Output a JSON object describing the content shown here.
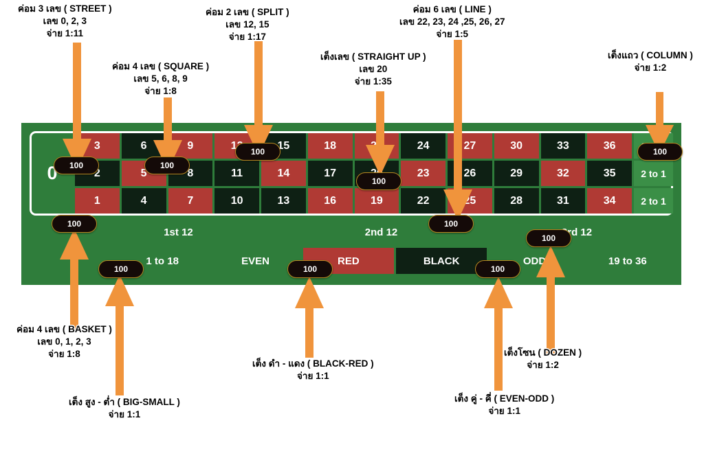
{
  "table": {
    "zero_label": "0",
    "numbers": [
      {
        "n": "3",
        "color": "red"
      },
      {
        "n": "6",
        "color": "black"
      },
      {
        "n": "9",
        "color": "red"
      },
      {
        "n": "12",
        "color": "red"
      },
      {
        "n": "15",
        "color": "black"
      },
      {
        "n": "18",
        "color": "red"
      },
      {
        "n": "21",
        "color": "red"
      },
      {
        "n": "24",
        "color": "black"
      },
      {
        "n": "27",
        "color": "red"
      },
      {
        "n": "30",
        "color": "red"
      },
      {
        "n": "33",
        "color": "black"
      },
      {
        "n": "36",
        "color": "red"
      },
      {
        "n": "2",
        "color": "black"
      },
      {
        "n": "5",
        "color": "red"
      },
      {
        "n": "8",
        "color": "black"
      },
      {
        "n": "11",
        "color": "black"
      },
      {
        "n": "14",
        "color": "red"
      },
      {
        "n": "17",
        "color": "black"
      },
      {
        "n": "20",
        "color": "black"
      },
      {
        "n": "23",
        "color": "red"
      },
      {
        "n": "26",
        "color": "black"
      },
      {
        "n": "29",
        "color": "black"
      },
      {
        "n": "32",
        "color": "red"
      },
      {
        "n": "35",
        "color": "black"
      },
      {
        "n": "1",
        "color": "red"
      },
      {
        "n": "4",
        "color": "black"
      },
      {
        "n": "7",
        "color": "red"
      },
      {
        "n": "10",
        "color": "black"
      },
      {
        "n": "13",
        "color": "black"
      },
      {
        "n": "16",
        "color": "red"
      },
      {
        "n": "19",
        "color": "red"
      },
      {
        "n": "22",
        "color": "black"
      },
      {
        "n": "25",
        "color": "red"
      },
      {
        "n": "28",
        "color": "black"
      },
      {
        "n": "31",
        "color": "black"
      },
      {
        "n": "34",
        "color": "red"
      }
    ],
    "column_bets": [
      "2 to 1",
      "2 to 1",
      "2 to 1"
    ],
    "dozens": [
      "1st 12",
      "2nd 12",
      "3rd 12"
    ],
    "outside": [
      {
        "label": "1 to 18",
        "color": "green"
      },
      {
        "label": "EVEN",
        "color": "green"
      },
      {
        "label": "RED",
        "color": "red"
      },
      {
        "label": "BLACK",
        "color": "black"
      },
      {
        "label": "ODD",
        "color": "green"
      },
      {
        "label": "19 to 36",
        "color": "green"
      }
    ],
    "colors": {
      "felt": "#2f7d3b",
      "cell_red": "#b03a34",
      "cell_black": "#0e2014",
      "column_green": "#3b8f47",
      "line": "#ffffff",
      "chip_body": "#140a08",
      "chip_rim": "#b98a22",
      "arrow": "#f0943c"
    }
  },
  "chips": [
    {
      "name": "chip-street",
      "value": "100"
    },
    {
      "name": "chip-square",
      "value": "100"
    },
    {
      "name": "chip-split",
      "value": "100"
    },
    {
      "name": "chip-straight-up",
      "value": "100"
    },
    {
      "name": "chip-line",
      "value": "100"
    },
    {
      "name": "chip-column",
      "value": "100"
    },
    {
      "name": "chip-basket",
      "value": "100"
    },
    {
      "name": "chip-big-small",
      "value": "100"
    },
    {
      "name": "chip-black-red",
      "value": "100"
    },
    {
      "name": "chip-even-odd",
      "value": "100"
    },
    {
      "name": "chip-dozen",
      "value": "100"
    }
  ],
  "annotations": {
    "street": {
      "l1": "ค่อม 3 เลข ( STREET )",
      "l2": "เลข 0, 2, 3",
      "l3": "จ่าย 1:11"
    },
    "square": {
      "l1": "ค่อม 4 เลข ( SQUARE )",
      "l2": "เลข 5, 6, 8, 9",
      "l3": "จ่าย 1:8"
    },
    "split": {
      "l1": "ค่อม 2 เลข ( SPLIT )",
      "l2": "เลข 12, 15",
      "l3": "จ่าย 1:17"
    },
    "straight_up": {
      "l1": "เต็งเลข ( STRAIGHT UP )",
      "l2": "เลข 20",
      "l3": "จ่าย 1:35"
    },
    "line": {
      "l1": "ค่อม 6 เลข ( LINE )",
      "l2": "เลข 22, 23, 24 ,25, 26, 27",
      "l3": "จ่าย 1:5"
    },
    "column": {
      "l1": "เต็งแถว ( COLUMN )",
      "l2": "จ่าย 1:2"
    },
    "basket": {
      "l1": "ค่อม 4 เลข ( BASKET )",
      "l2": "เลข 0, 1, 2, 3",
      "l3": "จ่าย 1:8"
    },
    "big_small": {
      "l1": "เต็ง สูง - ต่ำ ( BIG-SMALL )",
      "l2": "จ่าย 1:1"
    },
    "black_red": {
      "l1": "เต็ง ดำ - แดง ( BLACK-RED )",
      "l2": "จ่าย 1:1"
    },
    "even_odd": {
      "l1": "เต็ง คู่ - คี่ ( EVEN-ODD )",
      "l2": "จ่าย 1:1"
    },
    "dozen": {
      "l1": "เต็งโซน ( DOZEN )",
      "l2": "จ่าย 1:2"
    }
  }
}
